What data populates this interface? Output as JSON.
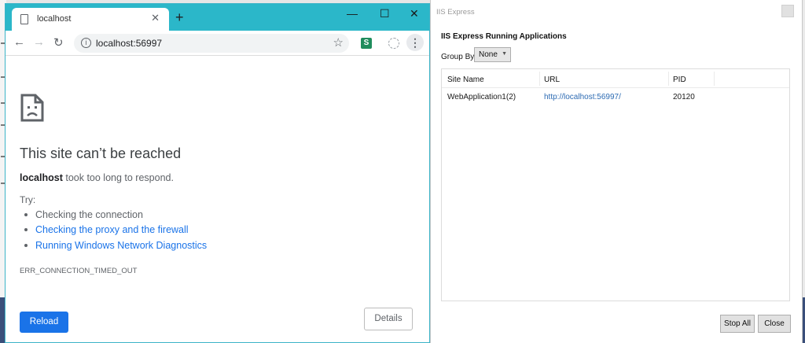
{
  "browser": {
    "tab_title": "localhost",
    "new_tab": "+",
    "window_controls": {
      "minimize": "—",
      "maximize": "☐",
      "close": "✕"
    },
    "url": "localhost:56997",
    "extension_label": "S",
    "menu": "⋮"
  },
  "error_page": {
    "title": "This site can’t be reached",
    "host": "localhost",
    "message": "took too long to respond.",
    "try_label": "Try:",
    "suggestions": [
      "Checking the connection",
      "Checking the proxy and the firewall",
      "Running Windows Network Diagnostics"
    ],
    "error_code": "ERR_CONNECTION_TIMED_OUT",
    "reload_label": "Reload",
    "details_label": "Details"
  },
  "iis": {
    "window_title": "IIS Express",
    "heading": "IIS Express Running Applications",
    "group_by_label": "Group By",
    "group_by_value": "None",
    "columns": [
      "Site Name",
      "URL",
      "PID"
    ],
    "rows": [
      {
        "site_name": "WebApplication1(2)",
        "url": "http://localhost:56997/",
        "pid": "20120"
      }
    ],
    "stop_all_label": "Stop All",
    "close_label": "Close"
  },
  "colors": {
    "chrome_frame": "#2bb7c9",
    "link": "#1a73e8",
    "primary_button": "#1a73e8"
  }
}
